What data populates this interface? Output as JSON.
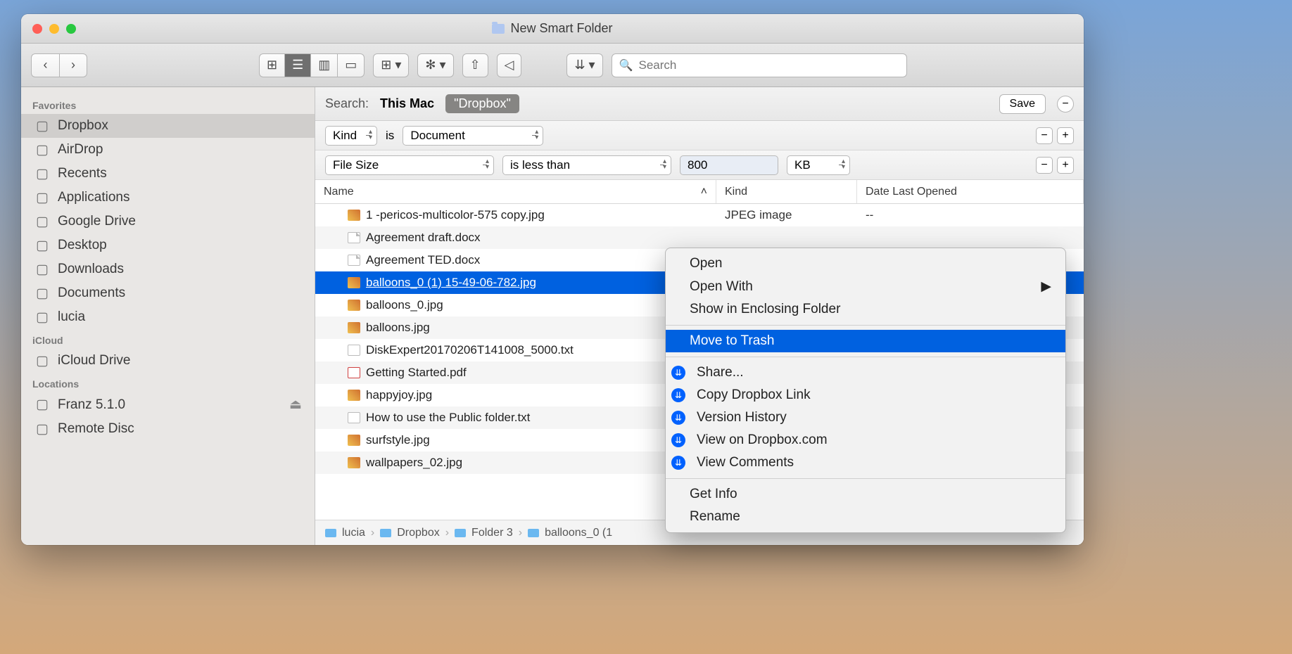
{
  "window_title": "New Smart Folder",
  "search_placeholder": "Search",
  "sidebar": {
    "sections": [
      {
        "label": "Favorites",
        "items": [
          {
            "name": "Dropbox",
            "selected": true
          },
          {
            "name": "AirDrop"
          },
          {
            "name": "Recents"
          },
          {
            "name": "Applications"
          },
          {
            "name": "Google Drive"
          },
          {
            "name": "Desktop"
          },
          {
            "name": "Downloads"
          },
          {
            "name": "Documents"
          },
          {
            "name": "lucia"
          }
        ]
      },
      {
        "label": "iCloud",
        "items": [
          {
            "name": "iCloud Drive"
          }
        ]
      },
      {
        "label": "Locations",
        "items": [
          {
            "name": "Franz 5.1.0",
            "eject": true
          },
          {
            "name": "Remote Disc"
          }
        ]
      }
    ]
  },
  "scope": {
    "label": "Search:",
    "mac": "This Mac",
    "pill": "\"Dropbox\"",
    "save": "Save"
  },
  "rule1": {
    "field": "Kind",
    "op": "is",
    "value": "Document"
  },
  "rule2": {
    "field": "File Size",
    "op": "is less than",
    "value": "800",
    "unit": "KB"
  },
  "columns": {
    "name": "Name",
    "kind": "Kind",
    "date": "Date Last Opened"
  },
  "files": [
    {
      "name": "1 -pericos-multicolor-575 copy.jpg",
      "kind": "JPEG image",
      "date": "--",
      "type": "jpg"
    },
    {
      "name": "Agreement draft.docx",
      "kind": "",
      "date": "",
      "type": "doc"
    },
    {
      "name": "Agreement TED.docx",
      "kind": "",
      "date": "",
      "type": "doc"
    },
    {
      "name": "balloons_0 (1) 15-49-06-782.jpg",
      "kind": "",
      "date": "",
      "type": "jpg",
      "selected": true
    },
    {
      "name": "balloons_0.jpg",
      "kind": "",
      "date": "",
      "type": "jpg"
    },
    {
      "name": "balloons.jpg",
      "kind": "",
      "date": "",
      "type": "jpg"
    },
    {
      "name": "DiskExpert20170206T141008_5000.txt",
      "kind": "",
      "date": "",
      "type": "txt"
    },
    {
      "name": "Getting Started.pdf",
      "kind": "",
      "date": "",
      "type": "pdf"
    },
    {
      "name": "happyjoy.jpg",
      "kind": "",
      "date": "",
      "type": "jpg"
    },
    {
      "name": "How to use the Public folder.txt",
      "kind": "",
      "date": "",
      "type": "txt"
    },
    {
      "name": "surfstyle.jpg",
      "kind": "",
      "date": "",
      "type": "jpg"
    },
    {
      "name": "wallpapers_02.jpg",
      "kind": "",
      "date": "",
      "type": "jpg"
    }
  ],
  "path": [
    "lucia",
    "Dropbox",
    "Folder 3",
    "balloons_0 (1"
  ],
  "menu": {
    "open": "Open",
    "openwith": "Open With",
    "enclosing": "Show in Enclosing Folder",
    "trash": "Move to Trash",
    "share": "Share...",
    "copylink": "Copy Dropbox Link",
    "history": "Version History",
    "viewon": "View on Dropbox.com",
    "comments": "View Comments",
    "getinfo": "Get Info",
    "rename": "Rename"
  }
}
